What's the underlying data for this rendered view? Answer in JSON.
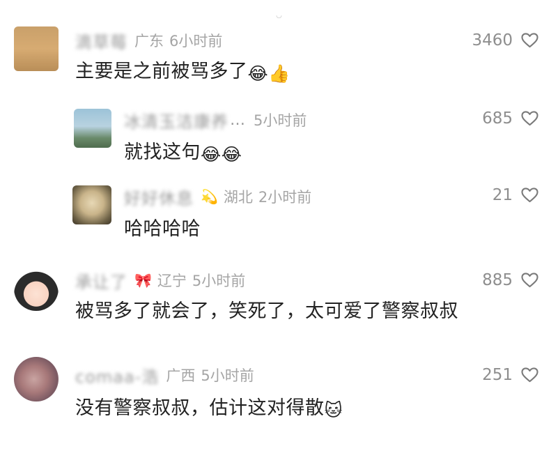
{
  "comments": [
    {
      "username": "滴草莓",
      "region": "广东",
      "time": "6小时前",
      "text": "主要是之前被骂多了",
      "emoji": "😂👍",
      "likes": "3460"
    },
    {
      "username": "冰清玉洁康养",
      "truncated": "…",
      "time": "5小时前",
      "text": "就找这句",
      "emoji": "😂😂",
      "likes": "685"
    },
    {
      "username": "好好休息",
      "badge": "💫",
      "region": "湖北",
      "time": "2小时前",
      "text": "哈哈哈哈",
      "likes": "21"
    },
    {
      "username": "承让了",
      "badge": "🎀",
      "region": "辽宁",
      "time": "5小时前",
      "text": "被骂多了就会了，笑死了，太可爱了警察叔叔",
      "likes": "885"
    },
    {
      "username": "comaa-浩",
      "region": "广西",
      "time": "5小时前",
      "text": "没有警察叔叔，估计这对得散",
      "emoji": "🐱",
      "likes": "251"
    }
  ],
  "colors": {
    "meta": "#a5a5a5",
    "body": "#222222",
    "likes": "#8e8e8e"
  },
  "icons": {
    "like": "heart-outline-icon"
  }
}
